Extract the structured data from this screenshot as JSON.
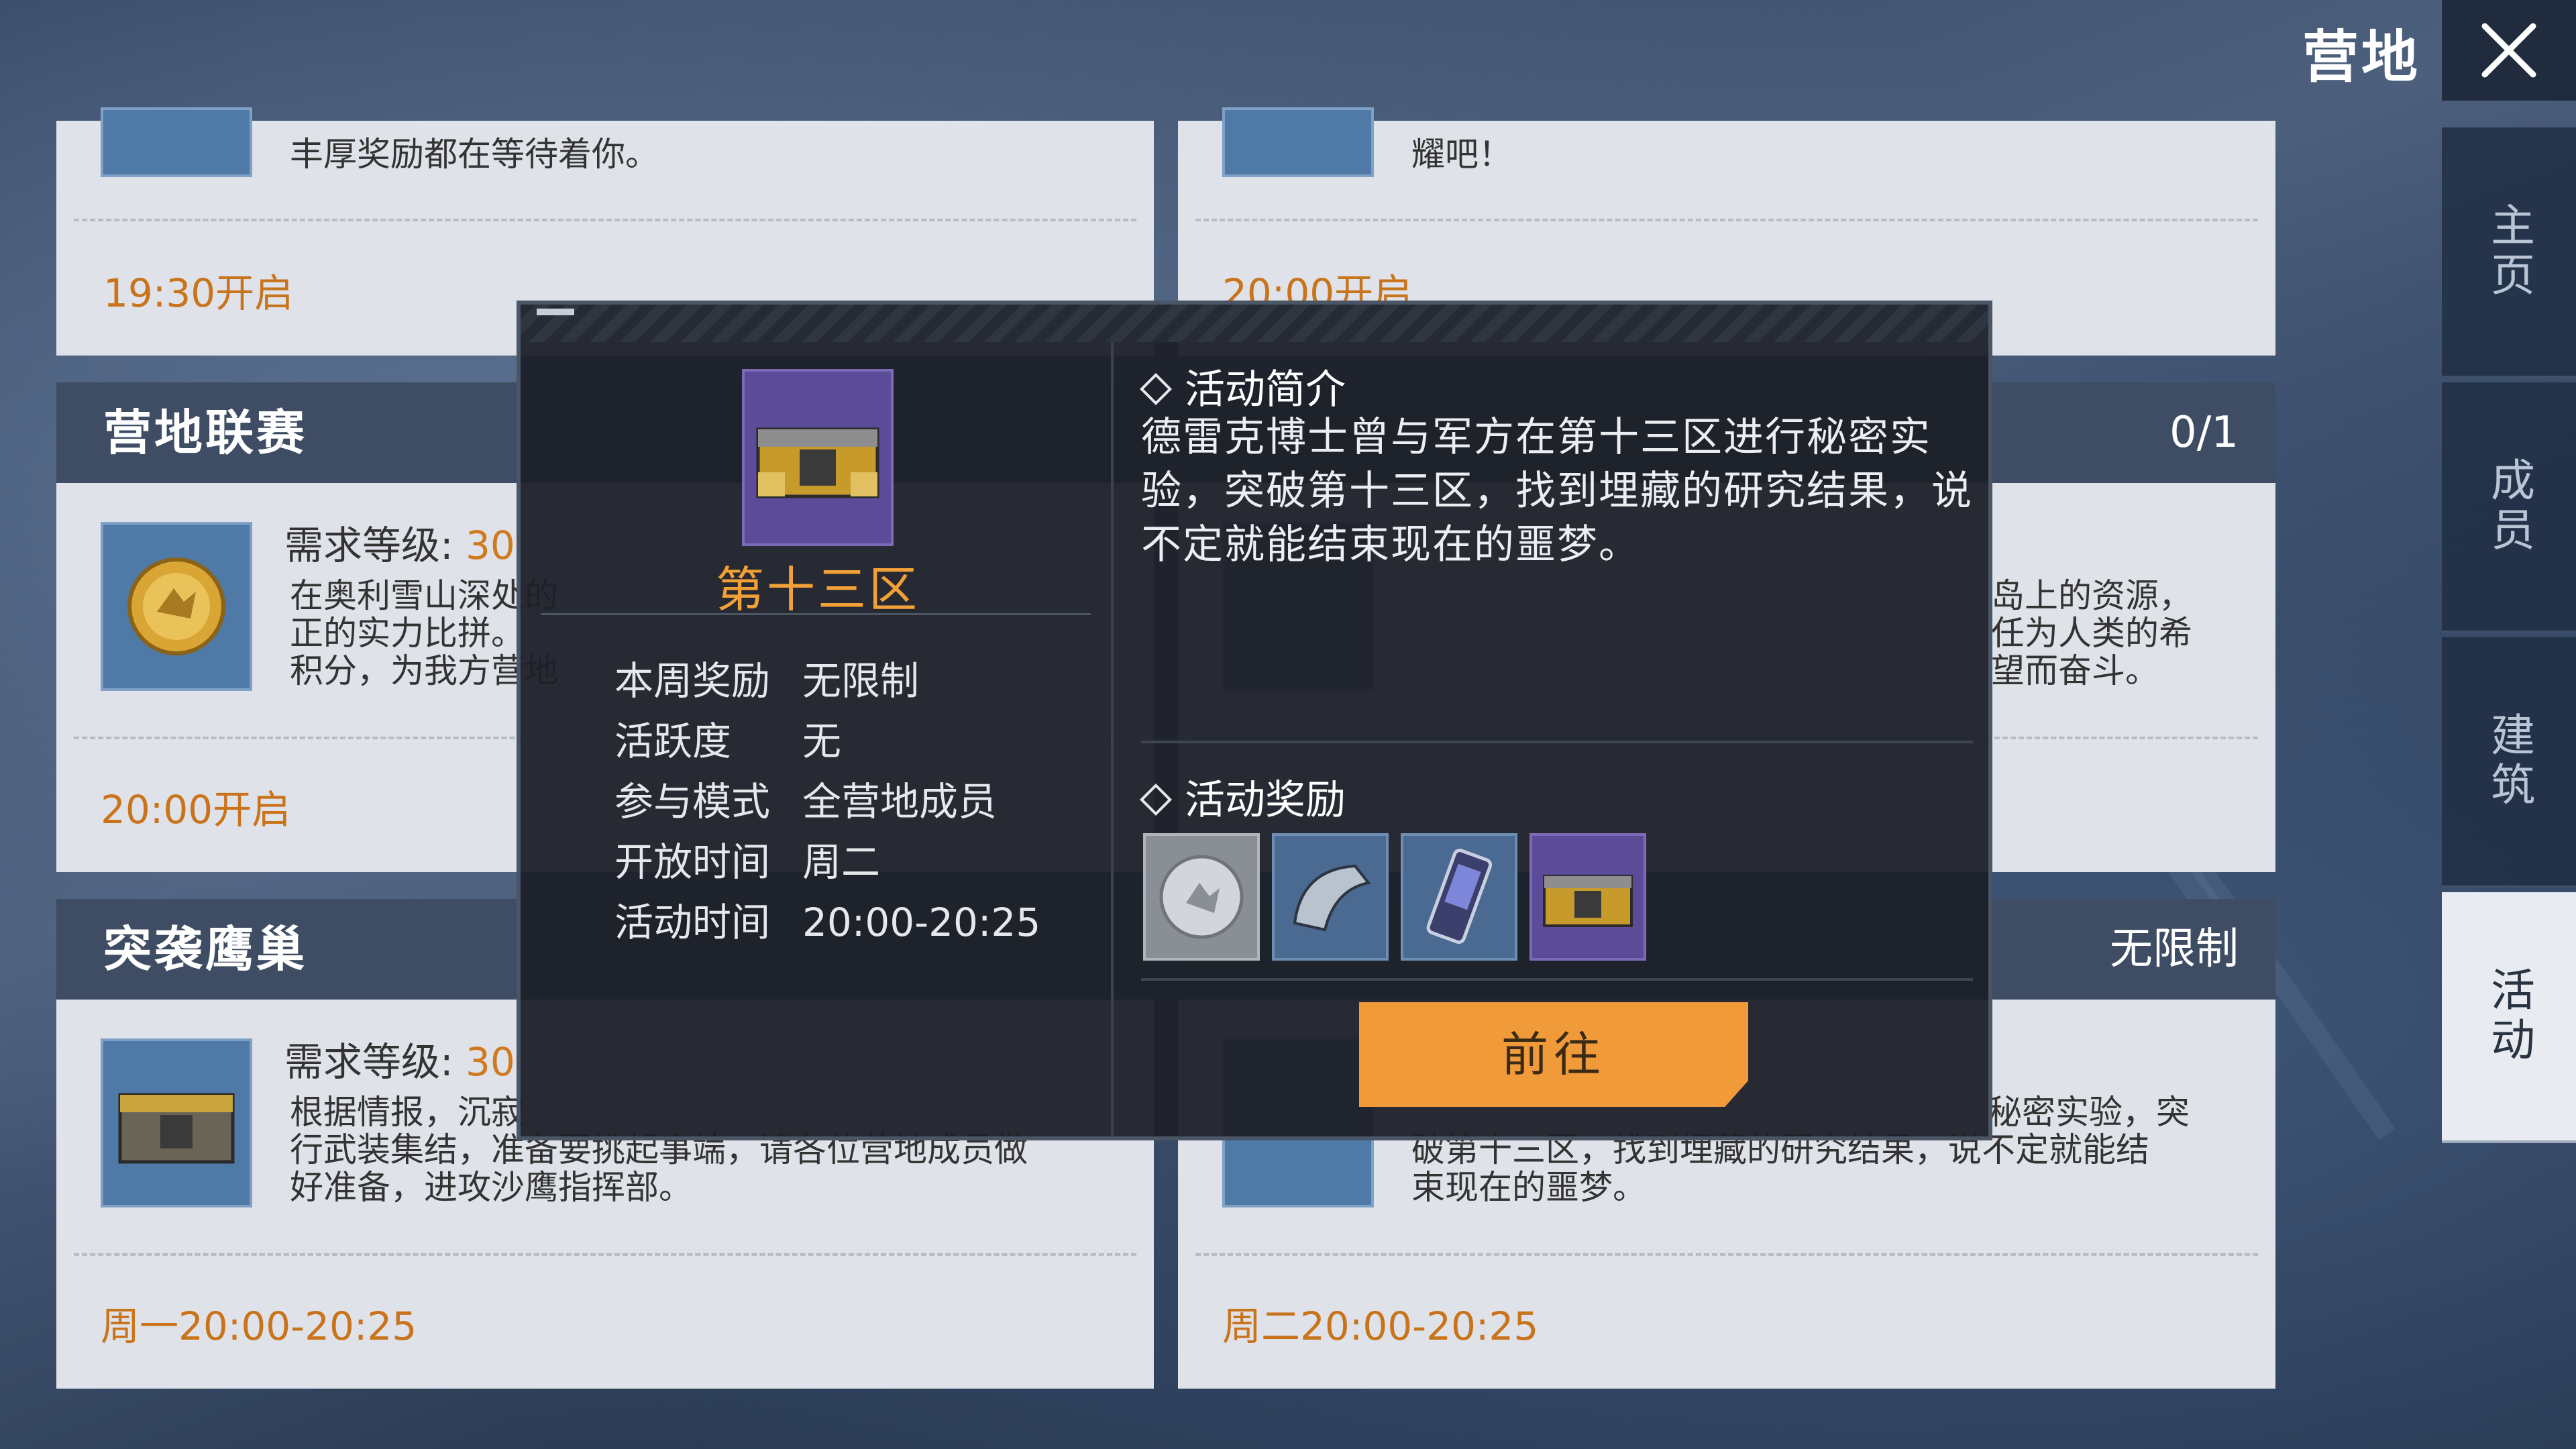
{
  "header": {
    "title": "营地",
    "close_icon": "close-icon"
  },
  "side_nav": [
    {
      "label": "主页",
      "active": false
    },
    {
      "label": "成员",
      "active": false
    },
    {
      "label": "建筑",
      "active": false
    },
    {
      "label": "活动",
      "active": true
    }
  ],
  "cards": {
    "top_left": {
      "desc": "丰厚奖励都在等待着你。",
      "time": "19:30开启"
    },
    "top_right": {
      "desc": "耀吧！",
      "time": "20:00开启"
    },
    "camp_league": {
      "title": "营地联赛",
      "req_label": "需求等级:",
      "req_level": "30",
      "desc": [
        "在奥利雪山深处的",
        "正的实力比拼。",
        "积分，为我方营地"
      ],
      "time": "20:00开启"
    },
    "mid_right": {
      "count": "0/1",
      "desc": [
        "岛上的资源，",
        "任为人类的希",
        "望而奋斗。"
      ]
    },
    "raid_nest": {
      "title": "突袭鹰巢",
      "req_label": "需求等级:",
      "req_level": "30",
      "desc": [
        "根据情报，沉寂",
        "行武装集结，准备要挑起事端，请各位营地成员做",
        "好准备，进攻沙鹰指挥部。"
      ],
      "time": "周一20:00-20:25"
    },
    "bottom_right": {
      "badge": "无限制",
      "desc": [
        "秘密实验，突",
        "破第十三区，找到埋藏的研究结果，说不定就能结",
        "束现在的噩梦。"
      ],
      "time": "周二20:00-20:25"
    }
  },
  "popup": {
    "name": "第十三区",
    "info": [
      {
        "k": "本周奖励",
        "v": "无限制"
      },
      {
        "k": "活跃度",
        "v": "无"
      },
      {
        "k": "参与模式",
        "v": "全营地成员"
      },
      {
        "k": "开放时间",
        "v": "周二"
      },
      {
        "k": "活动时间",
        "v": "20:00-20:25"
      }
    ],
    "intro_title": "活动简介",
    "intro_text": "德雷克博士曾与军方在第十三区进行秘密实验，突破第十三区，找到埋藏的研究结果，说不定就能结束现在的噩梦。",
    "reward_title": "活动奖励",
    "rewards": [
      "silver-coin-icon",
      "helmet-shard-icon",
      "chip-icon",
      "supply-crate-icon"
    ],
    "go_label": "前往"
  },
  "colors": {
    "accent": "#f19a3a",
    "time_text": "#c9731b",
    "popup_name": "#f2a038"
  }
}
